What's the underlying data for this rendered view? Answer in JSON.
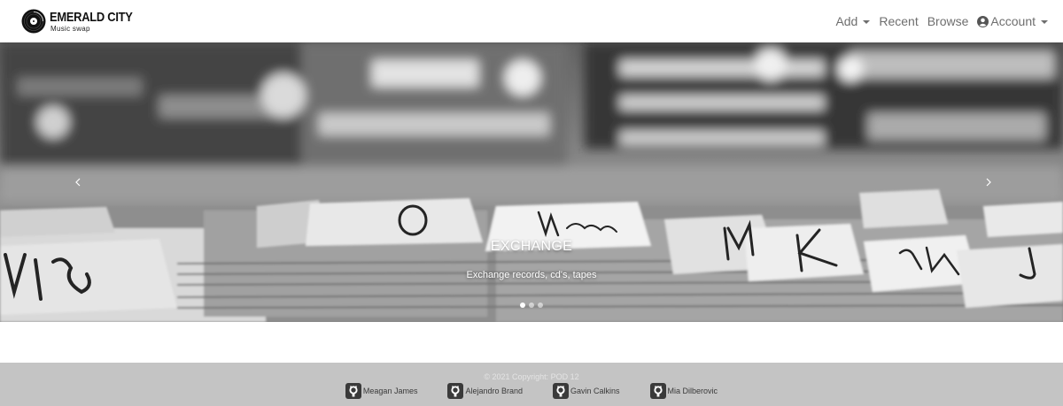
{
  "brand": {
    "title": "EMERALD CITY",
    "subtitle": "Music swap",
    "logo_icon": "vinyl-record-icon"
  },
  "nav": {
    "add": "Add",
    "recent": "Recent",
    "browse": "Browse",
    "account": "Account",
    "account_icon": "user-circle-icon"
  },
  "carousel": {
    "active_slide": 1,
    "slide_count": 3,
    "slide": {
      "title": "EXCHANGE",
      "text": "Exchange records, cd's, tapes",
      "divider_labels": [
        "O",
        "Madonna",
        "M",
        "K",
        "Synth",
        "J"
      ]
    },
    "prev_icon": "chevron-left-icon",
    "next_icon": "chevron-right-icon"
  },
  "footer": {
    "copyright": "© 2021 Copyright: POD 12",
    "contributors": [
      {
        "name": "Meagan James",
        "icon": "github-icon"
      },
      {
        "name": "Alejandro Brand",
        "icon": "github-icon"
      },
      {
        "name": "Gavin Calkins",
        "icon": "github-icon"
      },
      {
        "name": "Mia Dilberovic",
        "icon": "github-icon"
      }
    ]
  },
  "colors": {
    "nav_text": "#6e6e6e",
    "footer_bg": "#c4c4c4",
    "caption_text": "#ffffff"
  }
}
